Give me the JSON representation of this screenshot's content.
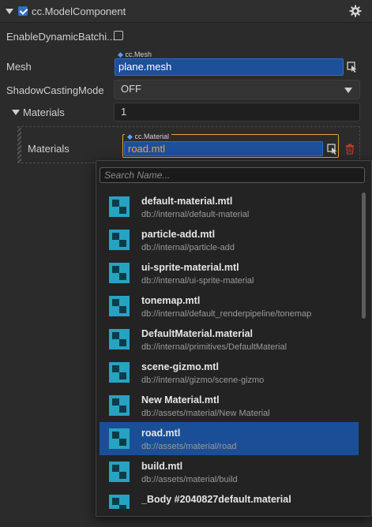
{
  "component": {
    "title": "cc.ModelComponent",
    "enabled": true
  },
  "properties": {
    "enable_dynamic_batching_label": "EnableDynamicBatchi...",
    "enable_dynamic_batching_checked": false,
    "mesh_label": "Mesh",
    "mesh_type_badge": "cc.Mesh",
    "mesh_value": "plane.mesh",
    "shadow_label": "ShadowCastingMode",
    "shadow_value": "OFF",
    "materials_group_label": "Materials",
    "materials_count": "1",
    "materials_item_label": "Materials",
    "material_type_badge": "cc.Material",
    "material_value": "road.mtl"
  },
  "picker": {
    "search_placeholder": "Search Name...",
    "items": [
      {
        "name": "default-material.mtl",
        "path": "db://internal/default-material",
        "selected": false
      },
      {
        "name": "particle-add.mtl",
        "path": "db://internal/particle-add",
        "selected": false
      },
      {
        "name": "ui-sprite-material.mtl",
        "path": "db://internal/ui-sprite-material",
        "selected": false
      },
      {
        "name": "tonemap.mtl",
        "path": "db://internal/default_renderpipeline/tonemap",
        "selected": false
      },
      {
        "name": "DefaultMaterial.material",
        "path": "db://internal/primitives/DefaultMaterial",
        "selected": false
      },
      {
        "name": "scene-gizmo.mtl",
        "path": "db://internal/gizmo/scene-gizmo",
        "selected": false
      },
      {
        "name": "New Material.mtl",
        "path": "db://assets/material/New Material",
        "selected": false
      },
      {
        "name": "road.mtl",
        "path": "db://assets/material/road",
        "selected": true
      },
      {
        "name": "build.mtl",
        "path": "db://assets/material/build",
        "selected": false
      },
      {
        "name": "_Body #2040827default.material",
        "path": "",
        "selected": false
      }
    ]
  },
  "colors": {
    "accent": "#1a4f98",
    "material_icon": "#27a3c2",
    "focus_border": "#e8a53a",
    "delete_icon": "#c0392b"
  },
  "icons": {
    "settings": "gear-icon",
    "pick": "pick-asset-icon",
    "delete": "trash-icon",
    "expand": "triangle-down-icon",
    "dropdown": "chevron-down-icon",
    "material": "material-icon"
  }
}
